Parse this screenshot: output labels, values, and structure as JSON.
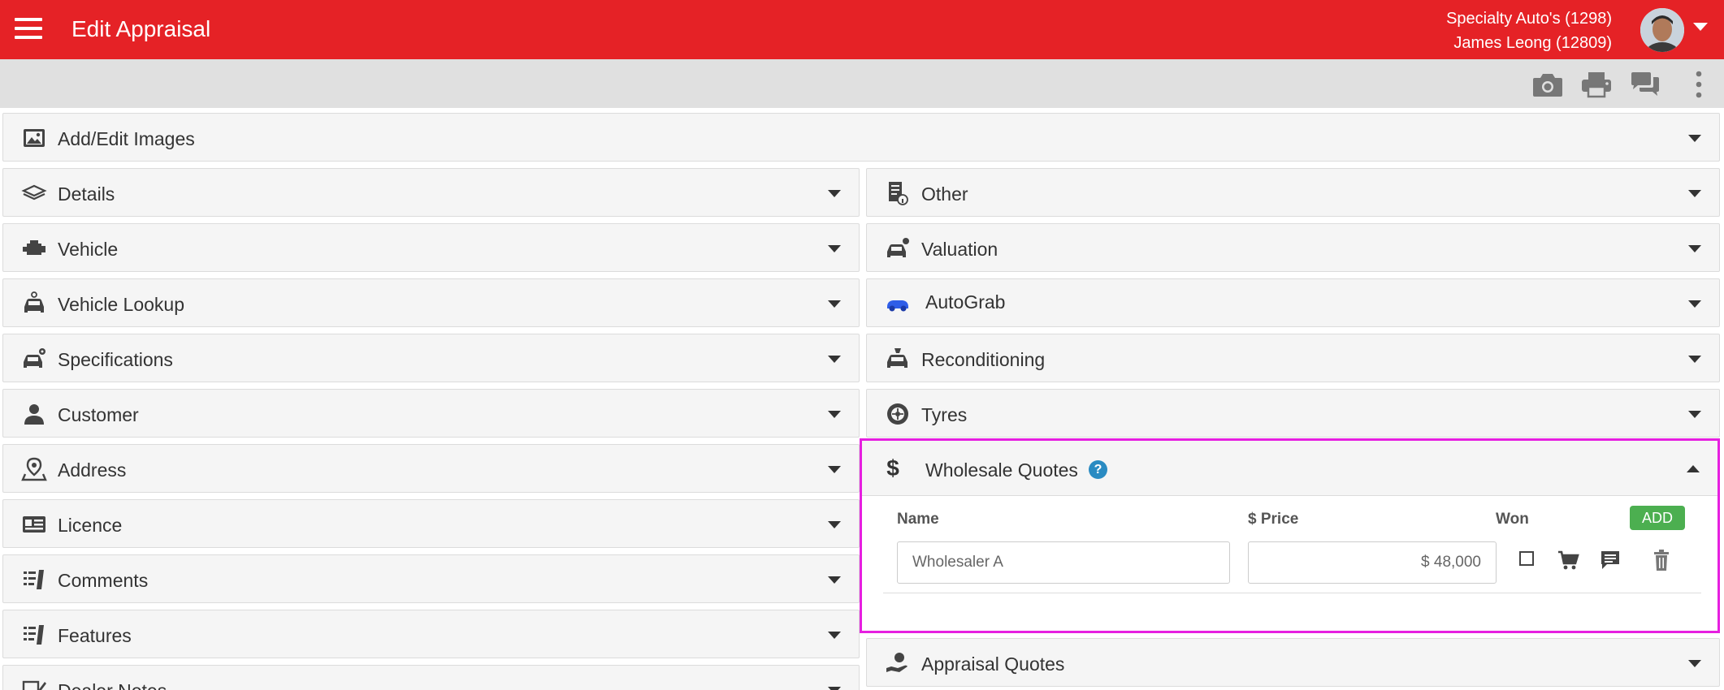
{
  "header": {
    "title": "Edit Appraisal",
    "dealer": "Specialty Auto's (1298)",
    "user": "James Leong (12809)"
  },
  "colors": {
    "brand": "#e52226",
    "highlight": "#e61fe0",
    "add": "#4caf50",
    "help": "#2a8bc2"
  },
  "toolbar_icons": [
    "camera-icon",
    "print-icon",
    "chat-icon",
    "more-vert-icon"
  ],
  "sections": {
    "images": "Add/Edit Images",
    "left": [
      "Details",
      "Vehicle",
      "Vehicle Lookup",
      "Specifications",
      "Customer",
      "Address",
      "Licence",
      "Comments",
      "Features",
      "Dealer Notes"
    ],
    "right": [
      "Other",
      "Valuation",
      "AutoGrab",
      "Reconditioning",
      "Tyres",
      "Wholesale Quotes",
      "Appraisal Quotes"
    ]
  },
  "wholesale": {
    "col_name": "Name",
    "col_price": "$ Price",
    "col_won": "Won",
    "add_label": "ADD",
    "help_label": "?",
    "rows": [
      {
        "name": "Wholesaler A",
        "price": "$ 48,000",
        "won": false
      }
    ]
  }
}
